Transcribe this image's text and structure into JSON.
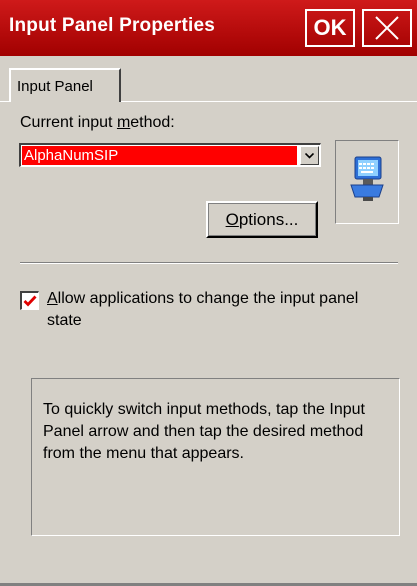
{
  "window": {
    "title": "Input Panel Properties",
    "ok_label": "OK",
    "close_icon": "close-icon"
  },
  "tabs": [
    {
      "label": "Input Panel",
      "selected": true
    }
  ],
  "input_method": {
    "label_before": "Current input ",
    "label_mnemonic": "m",
    "label_after": "ethod:",
    "selected_value": "AlphaNumSIP",
    "dropdown_icon": "chevron-down-icon",
    "preview_icon": "keyboard-computer-icon"
  },
  "options_button": {
    "mnemonic": "O",
    "rest": "ptions..."
  },
  "allow_change": {
    "checked": true,
    "mnemonic": "A",
    "rest": "llow applications to change the input panel state"
  },
  "info_text": "To quickly switch input methods, tap the Input Panel arrow and then tap the desired method from the menu that appears.",
  "colors": {
    "title_bar": "#b80808",
    "selection": "#ff0000",
    "check_mark": "#e00000",
    "face": "#d4d0c8"
  }
}
